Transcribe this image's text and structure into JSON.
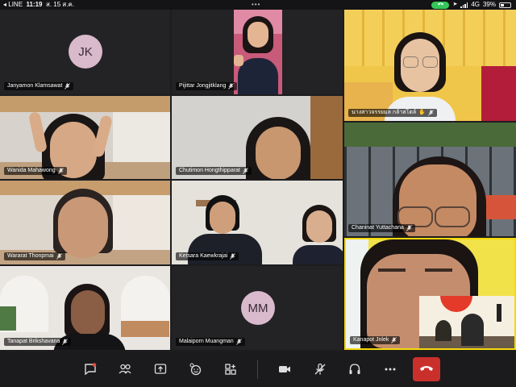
{
  "status_bar": {
    "back_label": "◂ LINE",
    "time": "11:19",
    "date": "ส. 15 ส.ค.",
    "network": "4G",
    "battery": "39%",
    "battery_level": 0.39
  },
  "participants": [
    {
      "name": "Janyamon Klamsawat",
      "initials": "JK",
      "video": false
    },
    {
      "name": "Pijittar Jongjitklang",
      "video": true
    },
    {
      "name": "นางสาวจรรยมล กล้าสโตล์",
      "video": true
    },
    {
      "name": "Wanida Mahawong",
      "video": true
    },
    {
      "name": "Chutimon Hongthipparat",
      "video": true
    },
    {
      "name": "Chaninat Yuttachana",
      "video": true
    },
    {
      "name": "Wararat Thonpmai",
      "video": true
    },
    {
      "name": "Ketsara Kaewkrajai",
      "video": true
    },
    {
      "name": "Tanapat Brikshavana",
      "video": true
    },
    {
      "name": "Malaiporn Muangman",
      "initials": "MM",
      "video": false
    },
    {
      "name": "Kanapot Jnlek",
      "video": true
    }
  ],
  "toolbar": {
    "buttons": [
      "chat-icon",
      "participants-icon",
      "share-screen-icon",
      "reactions-icon",
      "apps-icon",
      "video-camera-icon",
      "mic-muted-icon",
      "audio-icon",
      "more-icon",
      "leave-call-icon"
    ]
  },
  "colors": {
    "avatar_bg": "#d9b9cc",
    "leave": "#c9302c",
    "call_active": "#34c759"
  }
}
